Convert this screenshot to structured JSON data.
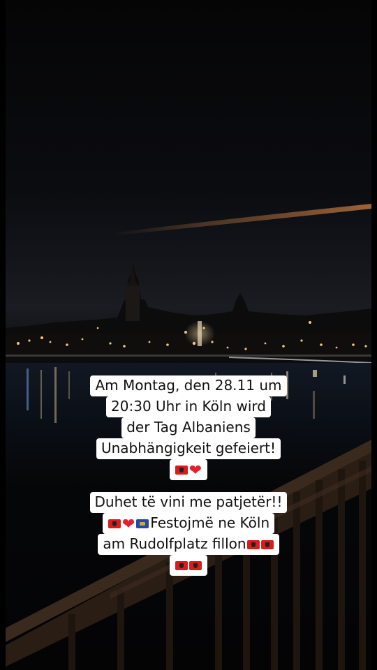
{
  "caption": {
    "block1": {
      "line1": "Am Montag, den 28.11 um",
      "line2": "20:30 Uhr in Köln wird",
      "line3": "der Tag Albaniens",
      "line4": "Unabhängigkeit gefeiert!"
    },
    "block2": {
      "line1": "Duhet të vini me patjetër!!",
      "line2": "Festojmë ne Köln",
      "line3": "am Rudolfplatz fillon"
    }
  },
  "emoji": {
    "albania_flag": "albania-flag-icon",
    "heart": "❤",
    "kosovo_flag": "kosovo-flag-icon"
  },
  "colors": {
    "caption_background": "#ffffff",
    "caption_text": "#111111",
    "flag_red": "#d91c1c",
    "heart_red": "#e5202b",
    "kosovo_blue": "#244aa5"
  }
}
